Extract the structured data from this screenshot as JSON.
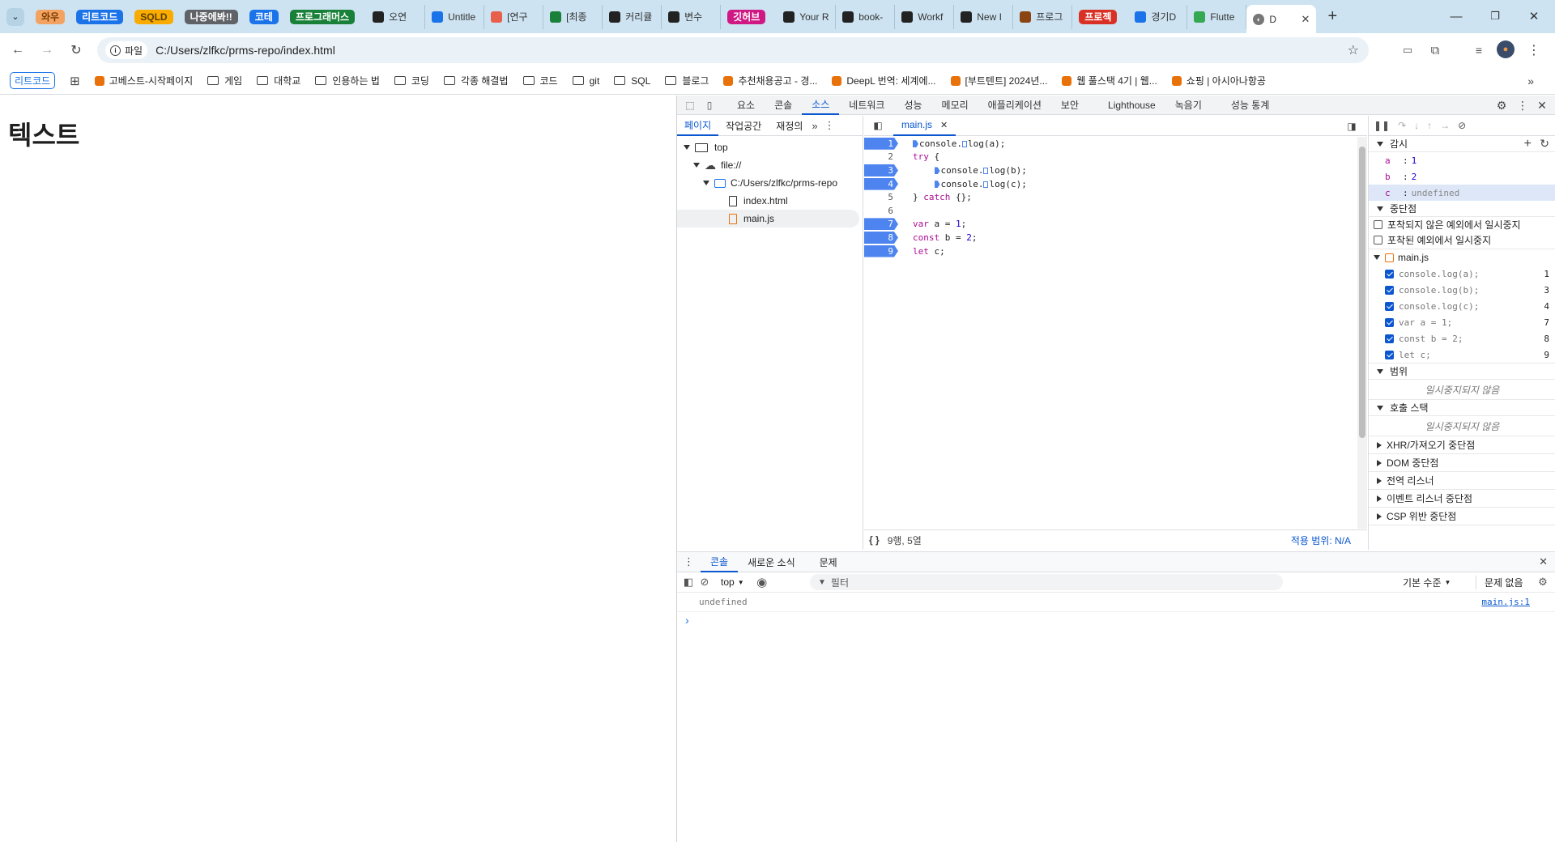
{
  "browser": {
    "tab_groups": [
      {
        "label": "와우",
        "color": "#f4a261",
        "text": "#7a3e00"
      },
      {
        "label": "리트코드",
        "color": "#1a73e8",
        "text": "#ffffff"
      },
      {
        "label": "SQLD",
        "color": "#f9ab00",
        "text": "#5a3e00"
      },
      {
        "label": "나중에봐!!",
        "color": "#5f6368",
        "text": "#ffffff"
      },
      {
        "label": "코테",
        "color": "#1a73e8",
        "text": "#ffffff"
      },
      {
        "label": "프로그래머스",
        "color": "#188038",
        "text": "#ffffff"
      }
    ],
    "tabs": [
      {
        "label": "오연",
        "icon": "notion-icon",
        "color": "#222222"
      },
      {
        "label": "Untitle",
        "icon": "share-icon",
        "color": "#1a73e8"
      },
      {
        "label": "[연구",
        "icon": "record-icon",
        "color": "#e8604c"
      },
      {
        "label": "[최종",
        "icon": "plus-icon",
        "color": "#188038"
      },
      {
        "label": "커리큘",
        "icon": "velog-icon",
        "color": "#222222"
      },
      {
        "label": "변수",
        "icon": "velog-icon",
        "color": "#222222"
      }
    ],
    "github_group": {
      "label": "깃허브",
      "color": "#d01884"
    },
    "tabs2": [
      {
        "label": "Your R",
        "icon": "github-icon",
        "color": "#222222"
      },
      {
        "label": "book-",
        "icon": "github-icon",
        "color": "#222222"
      },
      {
        "label": "Workf",
        "icon": "github-icon",
        "color": "#222222"
      },
      {
        "label": "New I",
        "icon": "github-icon",
        "color": "#222222"
      },
      {
        "label": "프로그",
        "icon": "image-icon",
        "color": "#8b4513"
      }
    ],
    "project_group": {
      "label": "프로젝",
      "color": "#d93025"
    },
    "tabs3": [
      {
        "label": "경기D",
        "icon": "edit-icon",
        "color": "#1a73e8"
      },
      {
        "label": "Flutte",
        "icon": "vue-icon",
        "color": "#34a853"
      }
    ],
    "active_tab": {
      "label": "D"
    },
    "address": {
      "scheme_label": "파일",
      "url": "C:/Users/zlfkc/prms-repo/index.html"
    },
    "bookmarks": [
      {
        "label": "리트코드",
        "type": "group"
      },
      {
        "label": "고베스트-시작페이지",
        "type": "site"
      },
      {
        "label": "게임",
        "type": "folder"
      },
      {
        "label": "대학교",
        "type": "folder"
      },
      {
        "label": "인용하는 법",
        "type": "folder"
      },
      {
        "label": "코딩",
        "type": "folder"
      },
      {
        "label": "각종 해결법",
        "type": "folder"
      },
      {
        "label": "코드",
        "type": "folder"
      },
      {
        "label": "git",
        "type": "folder"
      },
      {
        "label": "SQL",
        "type": "folder"
      },
      {
        "label": "블로그",
        "type": "folder"
      },
      {
        "label": "추천채용공고 - 경...",
        "type": "site"
      },
      {
        "label": "DeepL 번역: 세계에...",
        "type": "site"
      },
      {
        "label": "[부트텐트] 2024년...",
        "type": "site"
      },
      {
        "label": "웹 풀스택 4기 | 웹...",
        "type": "site"
      },
      {
        "label": "쇼핑 | 아시아나항공",
        "type": "site"
      }
    ]
  },
  "page": {
    "heading": "텍스트"
  },
  "devtools": {
    "tabs": [
      "요소",
      "콘솔",
      "소스",
      "네트워크",
      "성능",
      "메모리",
      "애플리케이션",
      "보안",
      "Lighthouse",
      "녹음기",
      "성능 통계"
    ],
    "active_tab": "소스",
    "navigator": {
      "tabs": [
        "페이지",
        "작업공간",
        "재정의"
      ],
      "active": "페이지",
      "tree": {
        "top": "top",
        "origin": "file://",
        "folder": "C:/Users/zlfkc/prms-repo",
        "files": [
          "index.html",
          "main.js"
        ],
        "selected": "main.js"
      }
    },
    "editor": {
      "open_file": "main.js",
      "lines": [
        {
          "n": "1",
          "bp": true,
          "html": "<span class='bpm'></span>console.<span class='bpm o'></span>log(a);"
        },
        {
          "n": "2",
          "bp": false,
          "html": "<span class='kw'>try</span> {"
        },
        {
          "n": "3",
          "bp": true,
          "html": "    <span class='bpm'></span>console.<span class='bpm o'></span>log(b);"
        },
        {
          "n": "4",
          "bp": true,
          "html": "    <span class='bpm'></span>console.<span class='bpm o'></span>log(c);"
        },
        {
          "n": "5",
          "bp": false,
          "html": "} <span class='kw'>catch</span> {};"
        },
        {
          "n": "6",
          "bp": false,
          "html": ""
        },
        {
          "n": "7",
          "bp": true,
          "html": "<span class='kw'>var</span> a = <span class='num'>1</span>;"
        },
        {
          "n": "8",
          "bp": true,
          "html": "<span class='kw'>const</span> b = <span class='num'>2</span>;"
        },
        {
          "n": "9",
          "bp": true,
          "html": "<span class='kw'>let</span> c;"
        }
      ],
      "status_position": "9행, 5열",
      "coverage": "적용 범위: N/A"
    },
    "debugger": {
      "watch_title": "감시",
      "watch": [
        {
          "name": "a",
          "value": "1"
        },
        {
          "name": "b",
          "value": "2"
        },
        {
          "name": "c",
          "value": "undefined"
        }
      ],
      "breakpoints_title": "중단점",
      "pause_uncaught": "포착되지 않은 예외에서 일시중지",
      "pause_caught": "포착된 예외에서 일시중지",
      "bp_file": "main.js",
      "breakpoints": [
        {
          "code": "console.log(a);",
          "line": "1"
        },
        {
          "code": "console.log(b);",
          "line": "3"
        },
        {
          "code": "console.log(c);",
          "line": "4"
        },
        {
          "code": "var a = 1;",
          "line": "7"
        },
        {
          "code": "const b = 2;",
          "line": "8"
        },
        {
          "code": "let c;",
          "line": "9"
        }
      ],
      "scope_title": "범위",
      "not_paused": "일시중지되지 않음",
      "callstack_title": "호출 스택",
      "collapsed": [
        "XHR/가져오기 중단점",
        "DOM 중단점",
        "전역 리스너",
        "이벤트 리스너 중단점",
        "CSP 위반 중단점"
      ]
    },
    "drawer": {
      "tabs": [
        "콘솔",
        "새로운 소식",
        "문제"
      ],
      "active": "콘솔",
      "context": "top",
      "filter_placeholder": "필터",
      "level": "기본 수준",
      "issues": "문제 없음",
      "messages": [
        {
          "text": "undefined",
          "source": "main.js:1"
        }
      ],
      "prompt": "›"
    }
  }
}
